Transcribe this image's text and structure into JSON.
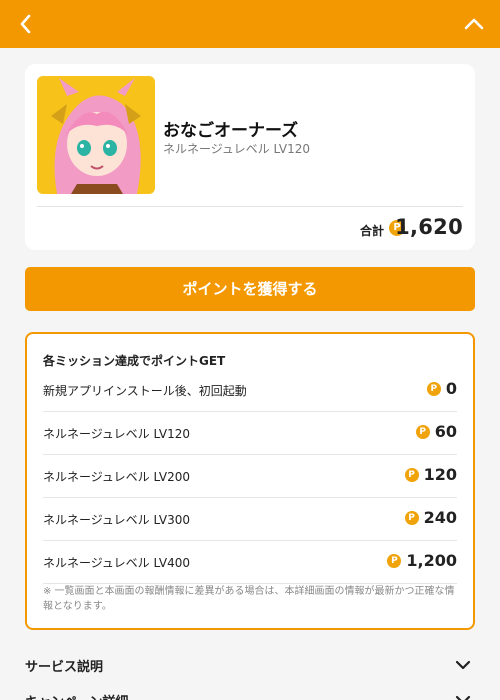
{
  "header": {
    "back_icon": "chevron-left-icon",
    "collapse_icon": "chevron-up-icon"
  },
  "app": {
    "name": "おなごオーナーズ",
    "level_label": "ネルネージュレベル LV120",
    "total_label": "合計",
    "total_points": "1,620"
  },
  "coin_symbol": "P",
  "get_button": "ポイントを獲得する",
  "missions": {
    "header": "各ミッション達成でポイントGET",
    "items": [
      {
        "name": "新規アプリインストール後、初回起動",
        "points": "0"
      },
      {
        "name": "ネルネージュレベル LV120",
        "points": "60"
      },
      {
        "name": "ネルネージュレベル LV200",
        "points": "120"
      },
      {
        "name": "ネルネージュレベル LV300",
        "points": "240"
      },
      {
        "name": "ネルネージュレベル LV400",
        "points": "1,200"
      }
    ],
    "note": "※ 一覧画面と本画面の報酬情報に差異がある場合は、本詳細画面の情報が最新かつ正確な情報となります。"
  },
  "sections": [
    {
      "label": "サービス説明"
    },
    {
      "label": "キャンペーン詳細"
    }
  ],
  "colors": {
    "accent": "#f39800",
    "coin": "#f0a30a",
    "background": "#f5f5f5"
  }
}
